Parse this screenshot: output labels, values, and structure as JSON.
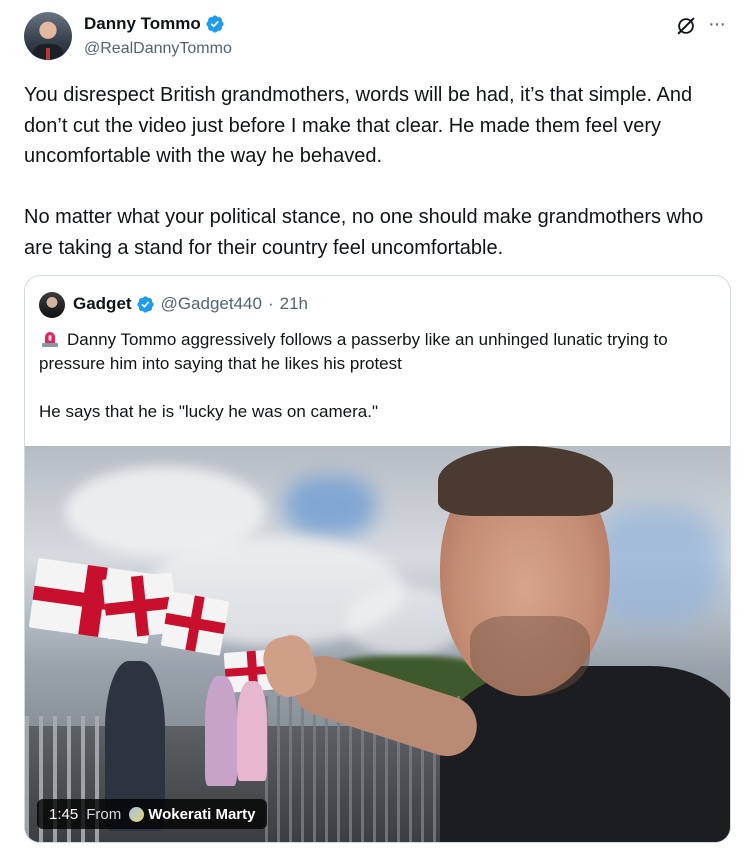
{
  "author": {
    "display_name": "Danny Tommo",
    "handle": "@RealDannyTommo",
    "verified": true
  },
  "icons": {
    "verified": "verified-badge-icon",
    "grok": "grok-icon",
    "more": "more-options-icon",
    "siren": "rotating-light-emoji"
  },
  "colors": {
    "verified_blue": "#1d9bf0",
    "text_secondary": "#536471",
    "border": "#cfd9de"
  },
  "tweet": {
    "paragraph_1": "You disrespect British grandmothers, words will be had, it’s that simple. And don’t cut the video just before I make that clear. He made them feel very uncomfortable with the way he behaved.",
    "paragraph_2": "No matter what your political stance, no one should make grandmothers who are taking a stand for their country feel uncomfortable."
  },
  "quote": {
    "display_name": "Gadget",
    "handle": "@Gadget440",
    "separator": "·",
    "time": "21h",
    "paragraph_1": "Danny Tommo aggressively follows a passerby like an unhinged lunatic trying to pressure him into saying that he likes his protest",
    "paragraph_2": "He says that he is \"lucky he was on camera.\"",
    "video": {
      "duration": "1:45",
      "from_label": "From",
      "source": "Wokerati Marty"
    }
  },
  "more_glyph": "···"
}
